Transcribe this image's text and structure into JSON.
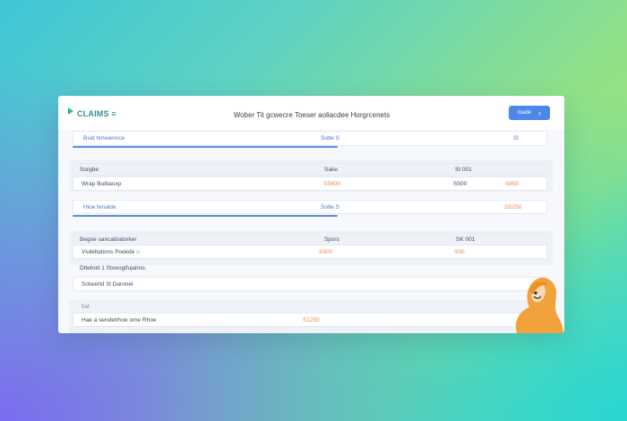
{
  "app": {
    "logo_text": "CLAIMS ≡",
    "title": "Wober Tit gcwecre Toeser aoliacdee Horgrcenets",
    "button_label": "Ioade",
    "button_chevron": "›"
  },
  "rows": {
    "r1": {
      "label": "Bsid hmeiennce",
      "mid": "Sotle S",
      "right": "Sl"
    },
    "r2": {
      "label": "Sorgbe",
      "mid": "Sake",
      "right": "St 001"
    },
    "r3": {
      "label": "Wrap Buibaoxp",
      "mid": "S5800",
      "mid2": "S500",
      "right": "S650"
    },
    "r4": {
      "label": "Hioe fenalde",
      "mid": "Sotle S",
      "right": "S52S0"
    },
    "r5": {
      "label": "Begoe sancatiratorker",
      "mid": "Spsrs",
      "right": "SK 001"
    },
    "r6": {
      "label": "Vsdeltations Poekde ⌂",
      "mid": "S500",
      "right": "S00"
    },
    "r7": {
      "label": "Dttebolt 1 Stoeogifujalmo.",
      "mid": "",
      "right": ""
    },
    "r8": {
      "label": "Sotwerld Sl Daronel",
      "mid": "",
      "right": ""
    },
    "r9": {
      "label": "fiat",
      "mid": "",
      "right": ""
    },
    "r10": {
      "label": "Hae a sendetrhoe ome Rhoe",
      "mid": "S1250",
      "right": ""
    }
  },
  "colors": {
    "accent": "#4d88e8",
    "orange": "#e88a4c",
    "logo": "#2f8c99"
  }
}
